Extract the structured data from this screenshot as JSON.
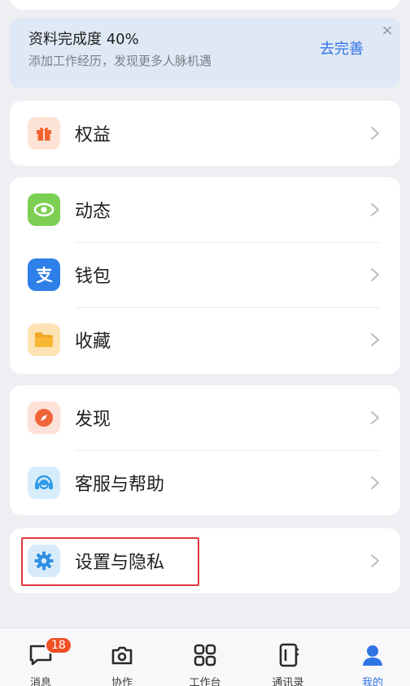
{
  "profile": {
    "title": "资料完成度 40%",
    "subtitle": "添加工作经历，发现更多人脉机遇",
    "action": "去完善",
    "close": "×"
  },
  "menu": {
    "benefits": "权益",
    "moments": "动态",
    "wallet": "钱包",
    "favorites": "收藏",
    "discover": "发现",
    "support": "客服与帮助",
    "settings": "设置与隐私"
  },
  "tabs": [
    {
      "label": "消息",
      "badge": "18"
    },
    {
      "label": "协作"
    },
    {
      "label": "工作台"
    },
    {
      "label": "通讯录"
    },
    {
      "label": "我的"
    }
  ],
  "colors": {
    "accent": "#2f74e4",
    "badge": "#f04e23",
    "highlight": "#e0393f"
  }
}
